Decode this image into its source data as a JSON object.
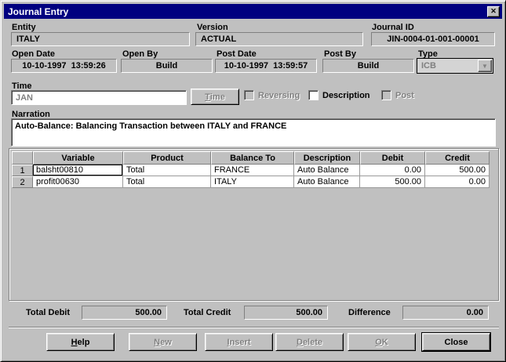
{
  "window": {
    "title": "Journal Entry",
    "close_glyph": "✕"
  },
  "fields": {
    "entity": {
      "label": "Entity",
      "value": "ITALY"
    },
    "version": {
      "label": "Version",
      "value": "ACTUAL"
    },
    "journal_id": {
      "label": "Journal ID",
      "value": "JIN-0004-01-001-00001"
    },
    "open_date": {
      "label": "Open Date",
      "value": "10-10-1997  13:59:26"
    },
    "open_by": {
      "label": "Open By",
      "value": "Build"
    },
    "post_date": {
      "label": "Post Date",
      "value": "10-10-1997  13:59:57"
    },
    "post_by": {
      "label": "Post By",
      "value": "Build"
    },
    "type": {
      "label": "Type",
      "value": "ICB",
      "dropdown_glyph": "▼"
    },
    "time": {
      "label": "Time",
      "value": "JAN"
    },
    "narration": {
      "label": "Narration",
      "value": "Auto-Balance: Balancing Transaction between ITALY and FRANCE"
    }
  },
  "time_button": {
    "label": "Time",
    "enabled": false
  },
  "checkboxes": [
    {
      "label": "Reversing",
      "checked": false,
      "enabled": false
    },
    {
      "label": "Description",
      "checked": false,
      "enabled": true
    },
    {
      "label": "Post",
      "checked": false,
      "enabled": false
    }
  ],
  "grid": {
    "columns": [
      "",
      "Variable",
      "Product",
      "Balance To",
      "Description",
      "Debit",
      "Credit"
    ],
    "rows": [
      [
        "1",
        "balsht00810",
        "Total",
        "FRANCE",
        "Auto Balance",
        "0.00",
        "500.00"
      ],
      [
        "2",
        "profit00630",
        "Total",
        "ITALY",
        "Auto Balance",
        "500.00",
        "0.00"
      ]
    ]
  },
  "totals": {
    "debit_label": "Total Debit",
    "debit_value": "500.00",
    "credit_label": "Total Credit",
    "credit_value": "500.00",
    "difference_label": "Difference",
    "difference_value": "0.00"
  },
  "buttons": [
    {
      "label": "Help",
      "enabled": true
    },
    {
      "label": "New",
      "enabled": false
    },
    {
      "label": "Insert",
      "enabled": false
    },
    {
      "label": "Delete",
      "enabled": false
    },
    {
      "label": "OK",
      "enabled": false
    },
    {
      "label": "Close",
      "enabled": true
    }
  ],
  "colors": {
    "titlebar": "#000080",
    "dialog_bg": "#c0c0c0",
    "disabled_text": "#808080"
  }
}
